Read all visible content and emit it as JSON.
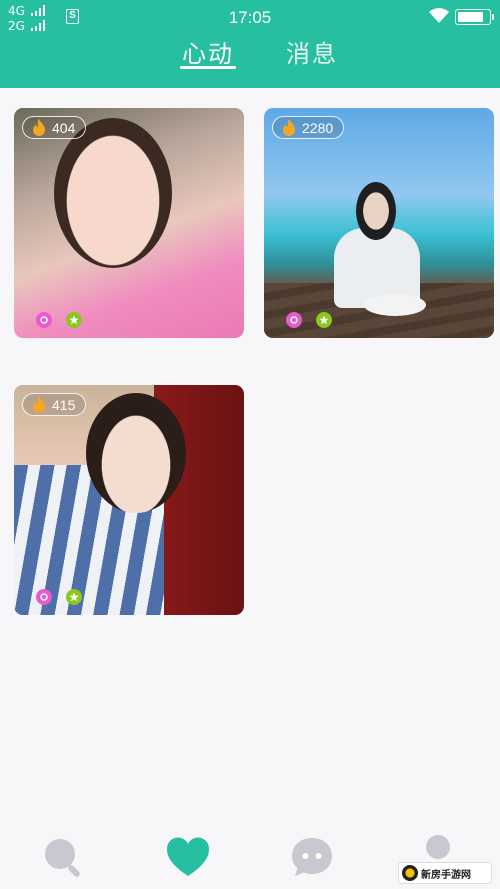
{
  "status_bar": {
    "network_top": "4G",
    "network_bottom": "2G",
    "sim_label": "S",
    "time": "17:05",
    "battery_level": 0.85
  },
  "tabs": [
    {
      "label": "心动",
      "active": true
    },
    {
      "label": "消息",
      "active": false
    }
  ],
  "cards": [
    {
      "hot_count": "404"
    },
    {
      "hot_count": "2280"
    },
    {
      "hot_count": "415"
    }
  ],
  "bottom_nav": [
    {
      "icon": "search-icon",
      "active": false
    },
    {
      "icon": "heart-icon",
      "active": true
    },
    {
      "icon": "chat-icon",
      "active": false
    },
    {
      "icon": "profile-icon",
      "active": false
    }
  ],
  "watermark": {
    "text": "新房手游网"
  },
  "colors": {
    "accent": "#26c0a0",
    "inactive_icon": "#c8c8d0",
    "badge_pink": "#e85bd0",
    "badge_green": "#8bc81f",
    "flame": "#f5a623"
  }
}
